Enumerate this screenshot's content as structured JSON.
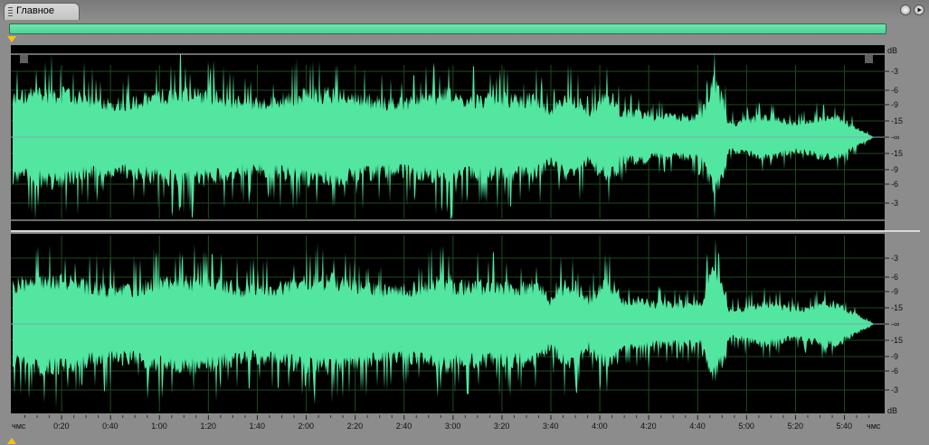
{
  "tab": {
    "label": "Главное",
    "icons": [
      "grip-icon"
    ]
  },
  "corner_buttons": [
    "options-icon",
    "play-icon"
  ],
  "colors": {
    "waveform": "#52e6a0",
    "background": "#000000",
    "grid": "#1e4a1e",
    "marker": "#f2c21a",
    "overview": "#5bdfa1"
  },
  "time_ruler": {
    "start_label": "чмс",
    "end_label": "чмс",
    "ticks": [
      "0:20",
      "0:40",
      "1:00",
      "1:20",
      "1:40",
      "2:00",
      "2:20",
      "2:40",
      "3:00",
      "3:20",
      "3:40",
      "4:00",
      "4:20",
      "4:40",
      "5:00",
      "5:20",
      "5:40"
    ],
    "duration_seconds": 352
  },
  "db_scale": {
    "unit": "dB",
    "upper_channel": [
      "-3",
      "-6",
      "-9",
      "-15",
      "-∞",
      "-15",
      "-9",
      "-6",
      "-3"
    ],
    "lower_channel": [
      "-3",
      "-6",
      "-9",
      "-15",
      "-∞",
      "-15",
      "-9",
      "-6",
      "-3"
    ],
    "bottom_unit": "dB"
  }
}
